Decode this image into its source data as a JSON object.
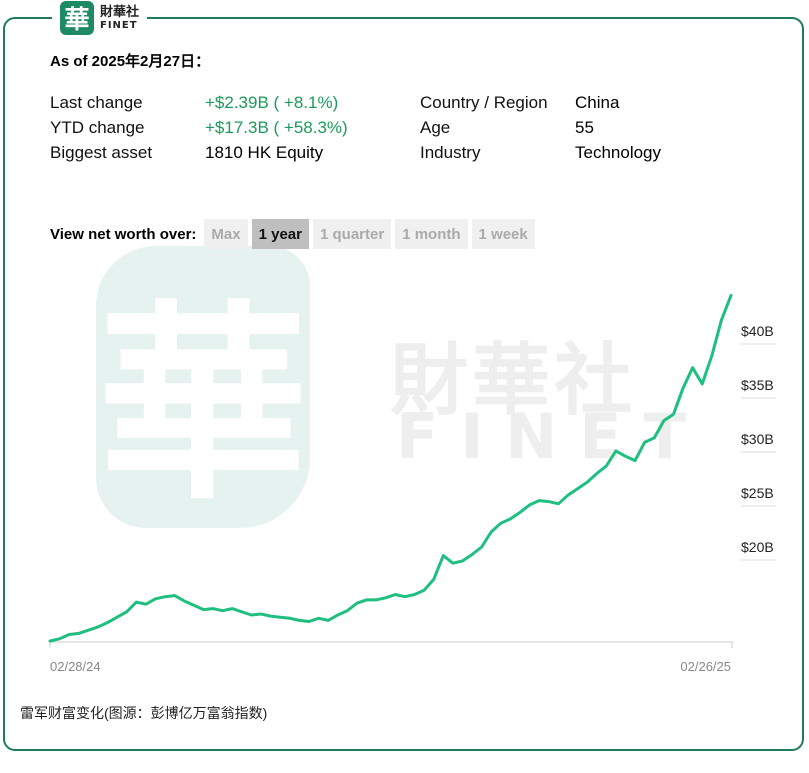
{
  "logo": {
    "glyph": "華",
    "cn": "財華社",
    "en": "FINET"
  },
  "as_of": "As of 2025年2月27日：",
  "stats_left": [
    {
      "label": "Last change",
      "value": "+$2.39B ( +8.1%)",
      "positive": true
    },
    {
      "label": "YTD change",
      "value": "+$17.3B ( +58.3%)",
      "positive": true
    },
    {
      "label": "Biggest asset",
      "value": "1810 HK Equity",
      "positive": false
    }
  ],
  "stats_right": [
    {
      "label": "Country / Region",
      "value": "China"
    },
    {
      "label": "Age",
      "value": "55"
    },
    {
      "label": "Industry",
      "value": "Technology"
    }
  ],
  "view": {
    "label": "View net worth over:",
    "buttons": [
      {
        "label": "Max",
        "active": false
      },
      {
        "label": "1 year",
        "active": true
      },
      {
        "label": "1 quarter",
        "active": false
      },
      {
        "label": "1 month",
        "active": false
      },
      {
        "label": "1 week",
        "active": false
      }
    ]
  },
  "watermark": {
    "glyph": "華",
    "cn": "財華社",
    "en": "FINET"
  },
  "caption": "雷军财富变化(图源：彭博亿万富翁指数)",
  "colors": {
    "line": "#1fbf7f",
    "frame": "#1e7b5b",
    "positive": "#1a9c5a"
  },
  "chart_data": {
    "type": "line",
    "x_start_label": "02/28/24",
    "x_end_label": "02/26/25",
    "yticks": [
      {
        "value": 40,
        "label": "$40B"
      },
      {
        "value": 35,
        "label": "$35B"
      },
      {
        "value": 30,
        "label": "$30B"
      },
      {
        "value": 25,
        "label": "$25B"
      },
      {
        "value": 20,
        "label": "$20B"
      }
    ],
    "ylim": [
      11,
      44
    ],
    "grid": false,
    "series": [
      {
        "values": [
          11.3,
          11.5,
          11.9,
          12.0,
          12.3,
          12.6,
          13.0,
          13.5,
          14.0,
          14.9,
          14.7,
          15.2,
          15.4,
          15.5,
          15.0,
          14.6,
          14.2,
          14.3,
          14.1,
          14.3,
          14.0,
          13.7,
          13.8,
          13.6,
          13.5,
          13.4,
          13.2,
          13.1,
          13.4,
          13.2,
          13.7,
          14.1,
          14.8,
          15.1,
          15.1,
          15.3,
          15.6,
          15.4,
          15.6,
          16.0,
          17.0,
          19.2,
          18.5,
          18.7,
          19.3,
          20.0,
          21.4,
          22.2,
          22.6,
          23.2,
          23.9,
          24.3,
          24.2,
          24.0,
          24.8,
          25.4,
          26.0,
          26.8,
          27.5,
          28.9,
          28.4,
          28.0,
          29.7,
          30.1,
          31.7,
          32.3,
          34.7,
          36.6,
          35.1,
          37.7,
          41.0,
          43.3
        ]
      }
    ]
  }
}
